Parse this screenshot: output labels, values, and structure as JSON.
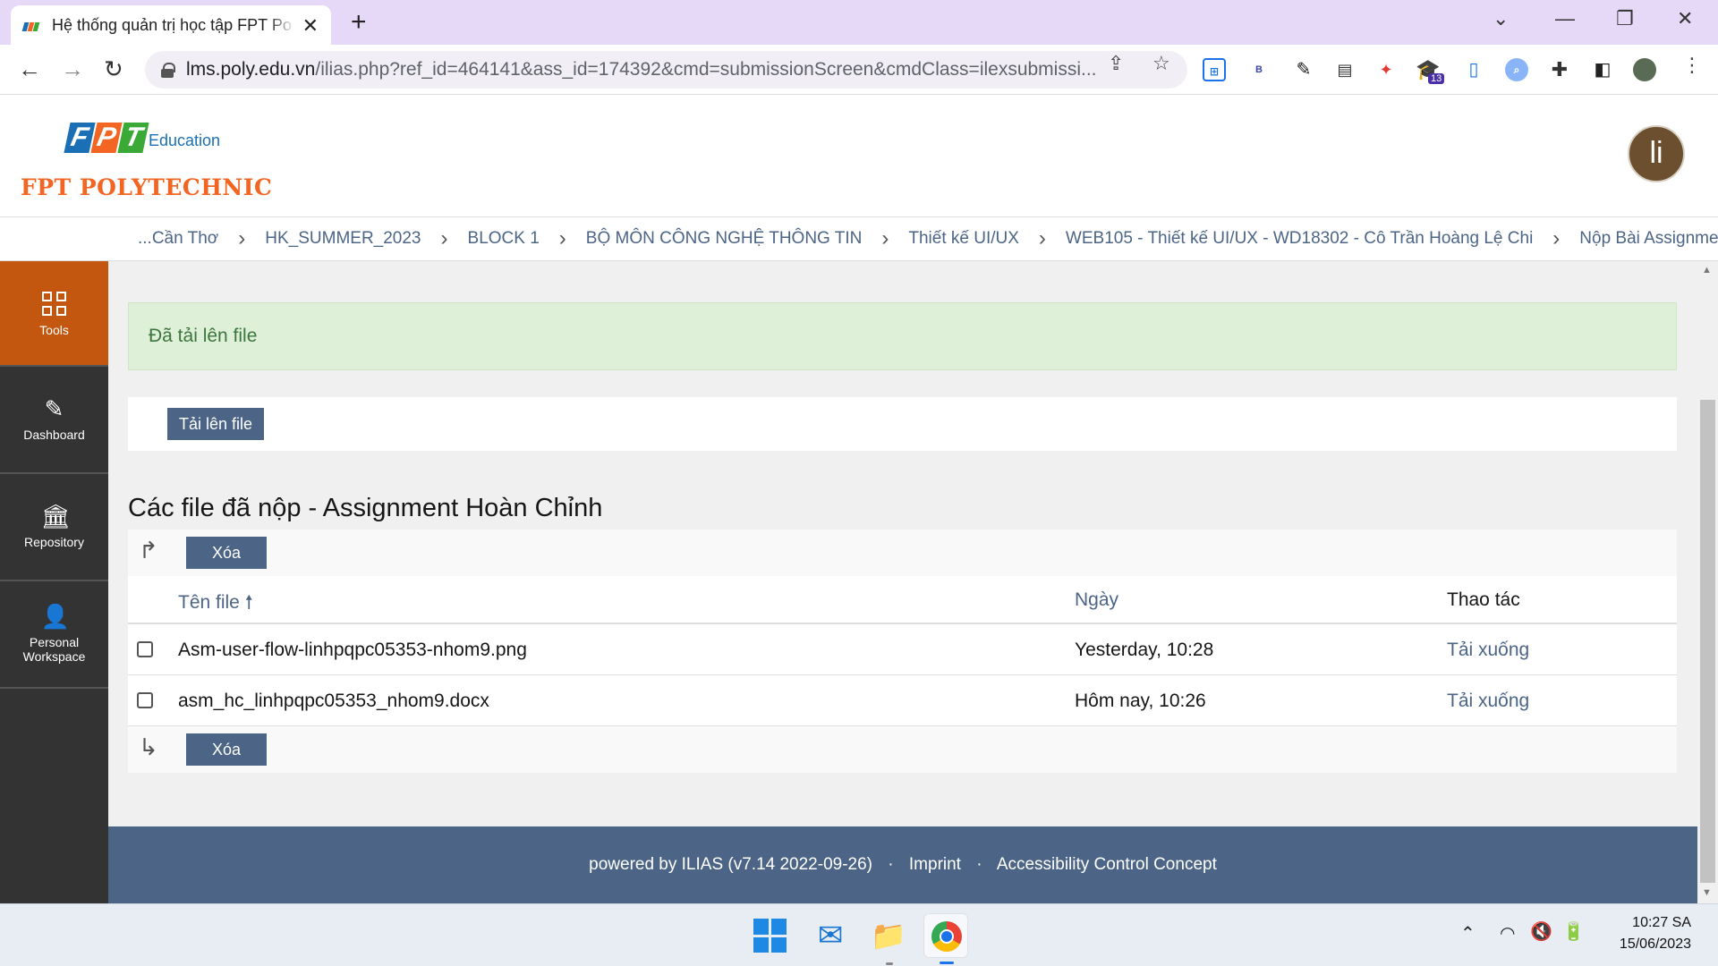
{
  "browser": {
    "tab_title": "Hệ thống quản trị học tập FPT Po",
    "url_host": "lms.poly.edu.vn",
    "url_rest": "/ilias.php?ref_id=464141&ass_id=174392&cmd=submissionScreen&cmdClass=ilexsubmissi...",
    "ext_badge": "13",
    "ext_b_label": "B"
  },
  "header": {
    "logo_letters": [
      "F",
      "P",
      "T"
    ],
    "logo_edu": "Education",
    "logo_poly": "FPT POLYTECHNIC",
    "avatar_initial": "li"
  },
  "breadcrumb": [
    "...Cần Thơ",
    "HK_SUMMER_2023",
    "BLOCK 1",
    "BỘ MÔN CÔNG NGHỆ THÔNG TIN",
    "Thiết kế UI/UX",
    "WEB105 - Thiết kế UI/UX - WD18302 - Cô Trần Hoàng Lệ Chi",
    "Nộp Bài Assignment"
  ],
  "leftnav": {
    "tools": "Tools",
    "dashboard": "Dashboard",
    "repository": "Repository",
    "personal_1": "Personal",
    "personal_2": "Workspace"
  },
  "main": {
    "alert": "Đã tải lên file",
    "upload_button": "Tải lên file",
    "section_title": "Các file đã nộp - Assignment Hoàn Chỉnh",
    "delete_button": "Xóa",
    "columns": {
      "filename": "Tên file",
      "date": "Ngày",
      "actions": "Thao tác"
    },
    "rows": [
      {
        "filename": "Asm-user-flow-linhpqpc05353-nhom9.png",
        "date": "Yesterday, 10:28",
        "action": "Tải xuống"
      },
      {
        "filename": "asm_hc_linhpqpc05353_nhom9.docx",
        "date": "Hôm nay, 10:26",
        "action": "Tải xuống"
      }
    ]
  },
  "footer": {
    "powered": "powered by ILIAS (v7.14 2022-09-26)",
    "imprint": "Imprint",
    "accessibility": "Accessibility Control Concept"
  },
  "taskbar": {
    "time": "10:27 SA",
    "date": "15/06/2023"
  },
  "colors": {
    "ilias_blue": "#4c6586",
    "active_nav": "#c4570f",
    "alert_bg": "#dff0d8",
    "tab_strip": "#e6d9f7"
  }
}
